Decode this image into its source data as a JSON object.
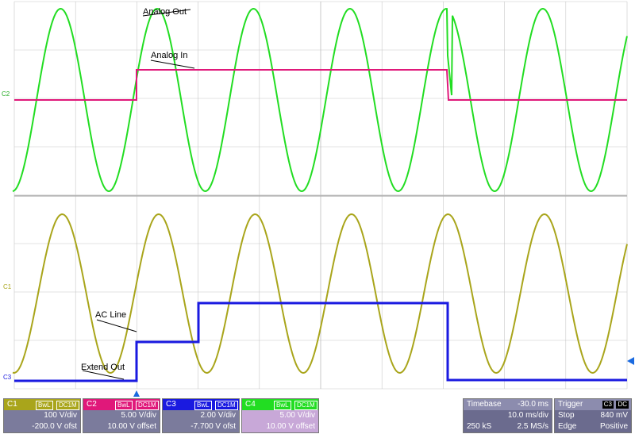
{
  "annotations": {
    "analog_out": "Analog Out",
    "analog_in": "Analog In",
    "ac_line": "AC Line",
    "extend_out": "Extend Out"
  },
  "markers": {
    "c2": "C2",
    "c1": "C1",
    "c3": "C3"
  },
  "colors": {
    "c1": "#a9a51b",
    "c2": "#e0187a",
    "c3": "#1a1ae0",
    "c4": "#22dd22",
    "grid": "#c8c8c8"
  },
  "channels": [
    {
      "id": "C1",
      "tag1": "BwL",
      "tag2": "DC1M",
      "scale": "100 V/div",
      "offset": "-200.0 V ofst",
      "color": "#a9a51b",
      "body": "#7b7b9c"
    },
    {
      "id": "C2",
      "tag1": "BwL",
      "tag2": "DC1M",
      "scale": "5.00 V/div",
      "offset": "10.00 V offset",
      "color": "#e0187a",
      "body": "#7b7b9c"
    },
    {
      "id": "C3",
      "tag1": "BwL",
      "tag2": "DC1M",
      "scale": "2.00 V/div",
      "offset": "-7.700 V ofst",
      "color": "#1a1ae0",
      "body": "#7b7b9c"
    },
    {
      "id": "C4",
      "tag1": "BwL",
      "tag2": "DC1M",
      "scale": "5.00 V/div",
      "offset": "10.00 V offset",
      "color": "#22dd22",
      "body": "#c8a8d8"
    }
  ],
  "timebase": {
    "label": "Timebase",
    "delay": "-30.0 ms",
    "div": "10.0 ms/div",
    "samples": "250 kS",
    "rate": "2.5 MS/s"
  },
  "trigger": {
    "label": "Trigger",
    "source": "C3",
    "coupling": "DC",
    "mode": "Stop",
    "level": "840 mV",
    "type": "Edge",
    "slope": "Positive"
  }
}
